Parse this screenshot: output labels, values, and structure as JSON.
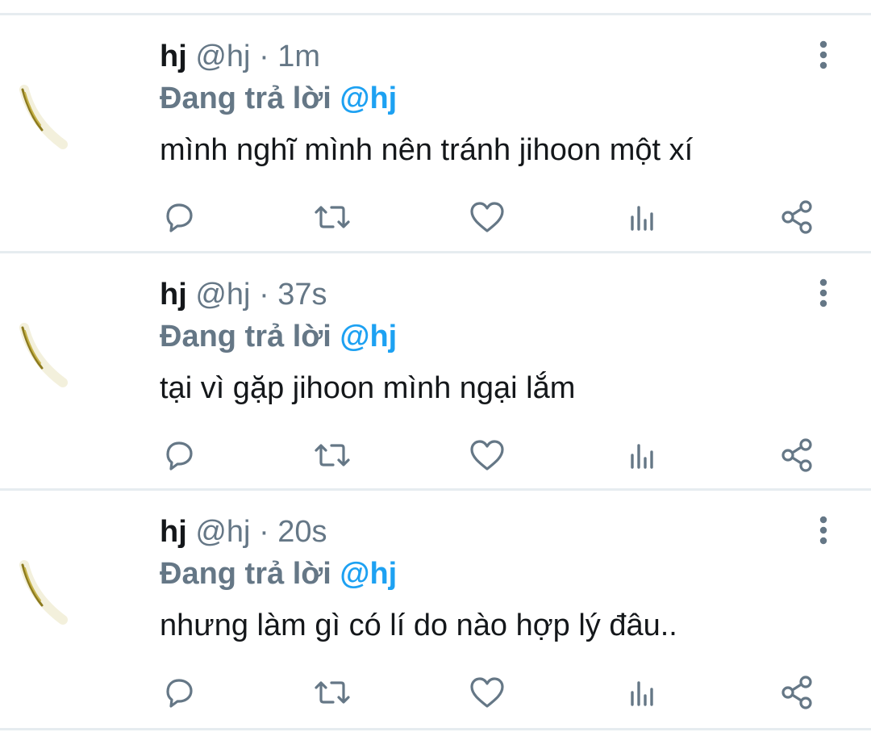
{
  "colors": {
    "primary_text": "#14171a",
    "secondary_text": "#657786",
    "mention": "#1da1f2",
    "divider": "#e6ecf0",
    "icon": "#657786"
  },
  "tweets": [
    {
      "name": "hj",
      "handle": "@hj",
      "separator": "·",
      "time": "1m",
      "reply_prefix": "Đang trả lời",
      "reply_to": "@hj",
      "text": "mình nghĩ mình nên tránh jihoon một xí",
      "icons": [
        "reply-icon",
        "retweet-icon",
        "like-icon",
        "analytics-icon",
        "share-icon",
        "more-options-icon"
      ]
    },
    {
      "name": "hj",
      "handle": "@hj",
      "separator": "·",
      "time": "37s",
      "reply_prefix": "Đang trả lời",
      "reply_to": "@hj",
      "text": "tại vì gặp jihoon mình ngại lắm",
      "icons": [
        "reply-icon",
        "retweet-icon",
        "like-icon",
        "analytics-icon",
        "share-icon",
        "more-options-icon"
      ]
    },
    {
      "name": "hj",
      "handle": "@hj",
      "separator": "·",
      "time": "20s",
      "reply_prefix": "Đang trả lời",
      "reply_to": "@hj",
      "text": "nhưng làm gì có lí do nào hợp lý đâu..",
      "icons": [
        "reply-icon",
        "retweet-icon",
        "like-icon",
        "analytics-icon",
        "share-icon",
        "more-options-icon"
      ]
    }
  ]
}
